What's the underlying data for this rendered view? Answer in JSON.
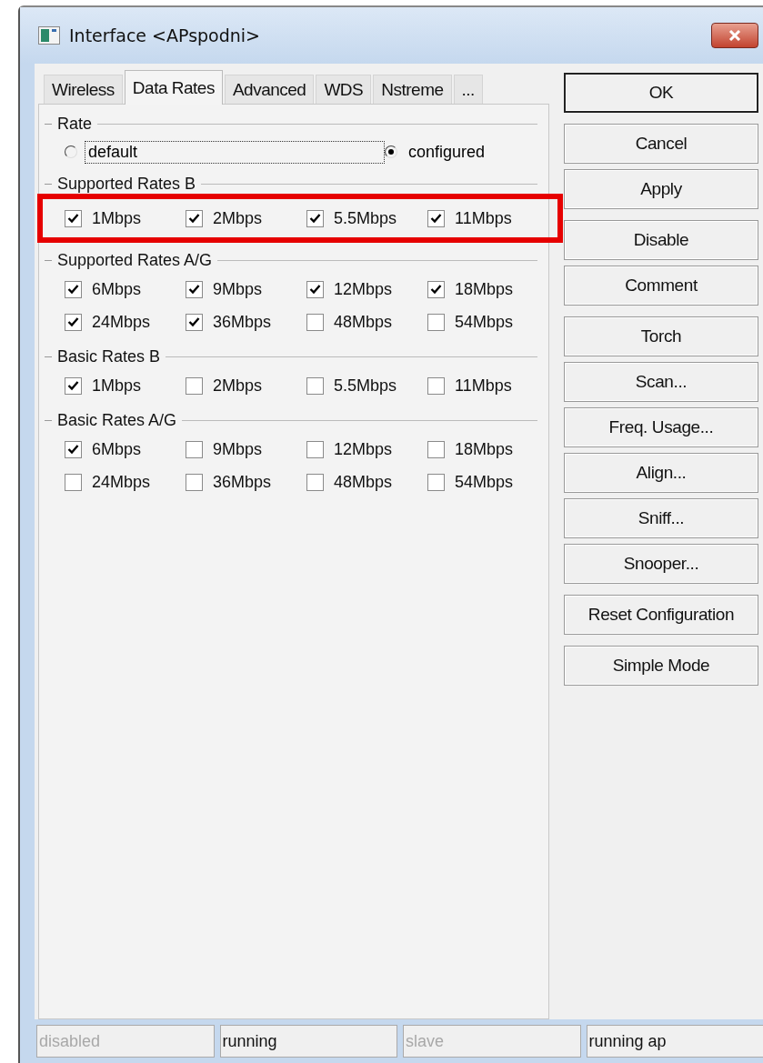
{
  "window": {
    "title": "Interface <APspodni>"
  },
  "tabs": [
    {
      "label": "Wireless",
      "selected": false
    },
    {
      "label": "Data Rates",
      "selected": true
    },
    {
      "label": "Advanced",
      "selected": false
    },
    {
      "label": "WDS",
      "selected": false
    },
    {
      "label": "Nstreme",
      "selected": false
    },
    {
      "label": "...",
      "selected": false
    }
  ],
  "rate": {
    "title": "Rate",
    "options": [
      {
        "label": "default",
        "selected": false,
        "focused": true
      },
      {
        "label": "configured",
        "selected": true,
        "focused": false
      }
    ]
  },
  "groups": [
    {
      "title": "Supported Rates B",
      "highlighted": true,
      "items": [
        {
          "label": "1Mbps",
          "checked": true
        },
        {
          "label": "2Mbps",
          "checked": true
        },
        {
          "label": "5.5Mbps",
          "checked": true
        },
        {
          "label": "11Mbps",
          "checked": true
        }
      ]
    },
    {
      "title": "Supported Rates A/G",
      "highlighted": false,
      "items": [
        {
          "label": "6Mbps",
          "checked": true
        },
        {
          "label": "9Mbps",
          "checked": true
        },
        {
          "label": "12Mbps",
          "checked": true
        },
        {
          "label": "18Mbps",
          "checked": true
        },
        {
          "label": "24Mbps",
          "checked": true
        },
        {
          "label": "36Mbps",
          "checked": true
        },
        {
          "label": "48Mbps",
          "checked": false
        },
        {
          "label": "54Mbps",
          "checked": false
        }
      ]
    },
    {
      "title": "Basic Rates B",
      "highlighted": false,
      "items": [
        {
          "label": "1Mbps",
          "checked": true
        },
        {
          "label": "2Mbps",
          "checked": false
        },
        {
          "label": "5.5Mbps",
          "checked": false
        },
        {
          "label": "11Mbps",
          "checked": false
        }
      ]
    },
    {
      "title": "Basic Rates A/G",
      "highlighted": false,
      "items": [
        {
          "label": "6Mbps",
          "checked": true
        },
        {
          "label": "9Mbps",
          "checked": false
        },
        {
          "label": "12Mbps",
          "checked": false
        },
        {
          "label": "18Mbps",
          "checked": false
        },
        {
          "label": "24Mbps",
          "checked": false
        },
        {
          "label": "36Mbps",
          "checked": false
        },
        {
          "label": "48Mbps",
          "checked": false
        },
        {
          "label": "54Mbps",
          "checked": false
        }
      ]
    }
  ],
  "button_groups": [
    [
      {
        "label": "OK",
        "default": true
      }
    ],
    [
      {
        "label": "Cancel",
        "default": false
      },
      {
        "label": "Apply",
        "default": false
      }
    ],
    [
      {
        "label": "Disable",
        "default": false
      },
      {
        "label": "Comment",
        "default": false
      }
    ],
    [
      {
        "label": "Torch",
        "default": false
      },
      {
        "label": "Scan...",
        "default": false
      },
      {
        "label": "Freq. Usage...",
        "default": false
      },
      {
        "label": "Align...",
        "default": false
      },
      {
        "label": "Sniff...",
        "default": false
      },
      {
        "label": "Snooper...",
        "default": false
      }
    ],
    [
      {
        "label": "Reset Configuration",
        "default": false
      }
    ],
    [
      {
        "label": "Simple Mode",
        "default": false
      }
    ]
  ],
  "status_bar": [
    {
      "text": "disabled",
      "dimmed": true
    },
    {
      "text": "running",
      "dimmed": false
    },
    {
      "text": "slave",
      "dimmed": true
    },
    {
      "text": "running ap",
      "dimmed": false
    }
  ]
}
